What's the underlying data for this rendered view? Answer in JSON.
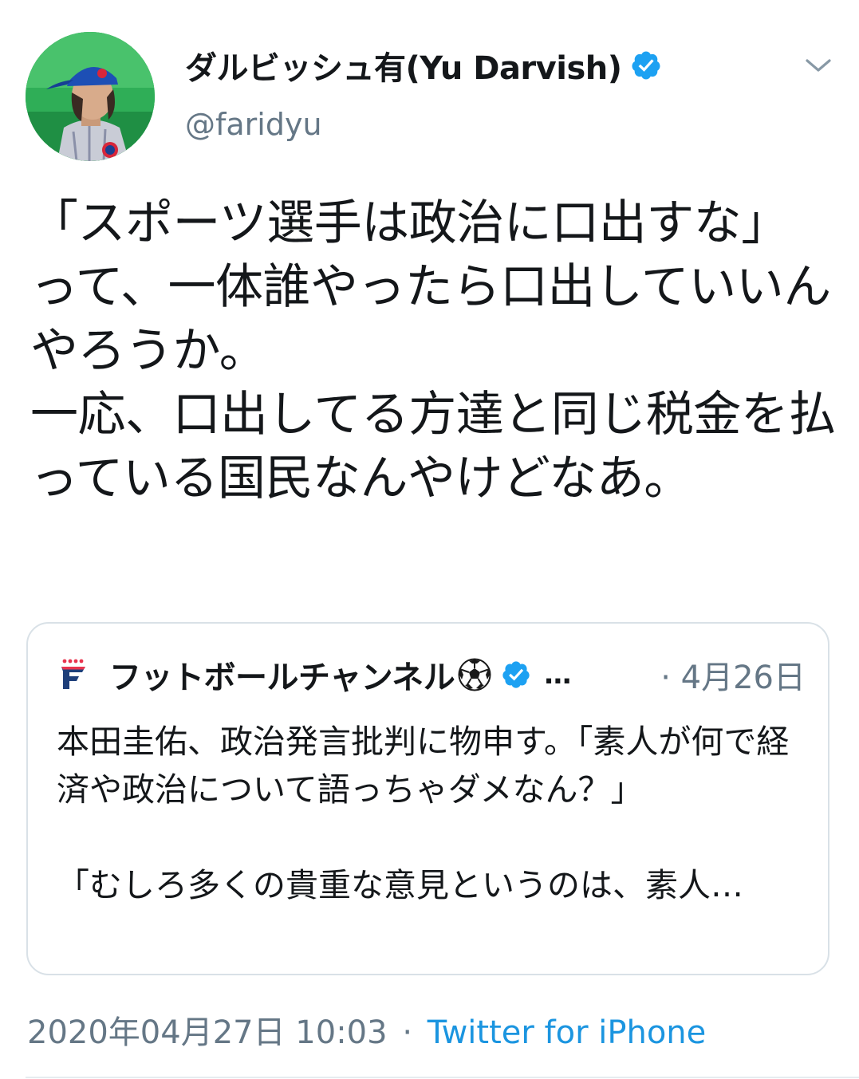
{
  "author": {
    "display_name": "ダルビッシュ有(Yu Darvish)",
    "handle": "@faridyu",
    "verified": true,
    "avatar_icon": "user-avatar"
  },
  "tweet": {
    "text": "「スポーツ選手は政治に口出すな」って、一体誰やったら口出していいんやろうか。\n一応、口出してる方達と同じ税金を払っている国民なんやけどなあ。"
  },
  "quoted_tweet": {
    "display_name": "フットボールチャンネル",
    "emoji_icon": "soccer-ball-icon",
    "verified": true,
    "truncation": "…",
    "date": "· 4月26日",
    "text": "本田圭佑、政治発言批判に物申す。「素人が何で経済や政治について語っちゃダメなん？」\n\n「むしろ多くの貴重な意見というのは、素人…"
  },
  "meta": {
    "timestamp": "2020年04月27日 10:03",
    "separator": "·",
    "source": "Twitter for iPhone"
  },
  "colors": {
    "text": "#14171a",
    "secondary": "#657786",
    "link": "#1b95e0",
    "verified": "#1da1f2",
    "border": "#d9e1e7"
  }
}
